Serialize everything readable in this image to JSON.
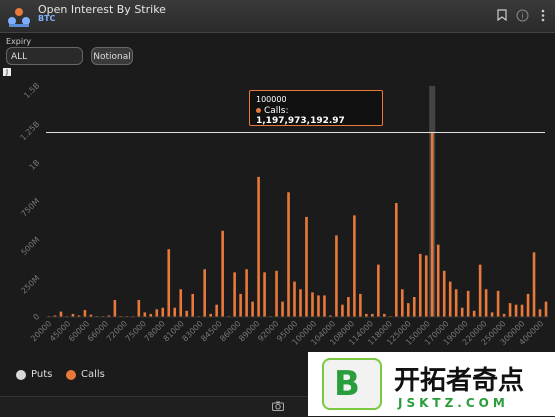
{
  "header": {
    "title": "Open Interest By Strike",
    "subtitle": "BTC"
  },
  "controls": {
    "expiry_label": "Expiry",
    "expiry_value": "ALL",
    "notional_label": "Notional",
    "small_box": "J"
  },
  "icons": {
    "bookmark": "bookmark-icon",
    "info": "info-icon",
    "menu": "menu-icon",
    "camera": "camera-icon"
  },
  "legend": [
    {
      "label": "Puts",
      "color": "#d9d9d9"
    },
    {
      "label": "Calls",
      "color": "#e8793b"
    }
  ],
  "tooltip": {
    "strike": "100000",
    "series": "Calls",
    "value": "1,197,973,192.97"
  },
  "watermark": {
    "cn": "开拓者奇点",
    "en": "JSKTZ.COM"
  },
  "chart_data": {
    "type": "bar",
    "title": "Open Interest By Strike",
    "y_ticks": [
      "0",
      "250M",
      "500M",
      "750M",
      "1B",
      "1.25B",
      "1.5B"
    ],
    "ylim": [
      0,
      1500000000
    ],
    "x_tick_labels": [
      "20000",
      "45000",
      "60000",
      "66000",
      "72000",
      "75000",
      "78000",
      "81000",
      "83000",
      "84500",
      "86000",
      "89000",
      "92000",
      "95000",
      "100000",
      "104000",
      "108000",
      "114000",
      "118000",
      "125000",
      "150000",
      "170000",
      "190000",
      "220000",
      "250000",
      "300000",
      "400000"
    ],
    "reference_line": 1197973192.97,
    "highlight_index": 64,
    "series": [
      {
        "name": "Calls",
        "color": "#e8793b",
        "values": [
          5000000,
          10000000,
          35000000,
          5000000,
          20000000,
          10000000,
          45000000,
          15000000,
          5000000,
          0,
          10000000,
          110000000,
          0,
          0,
          0,
          110000000,
          30000000,
          20000000,
          50000000,
          60000000,
          440000000,
          60000000,
          180000000,
          40000000,
          150000000,
          0,
          310000000,
          20000000,
          80000000,
          560000000,
          0,
          290000000,
          150000000,
          310000000,
          100000000,
          910000000,
          290000000,
          0,
          300000000,
          100000000,
          810000000,
          230000000,
          180000000,
          650000000,
          160000000,
          140000000,
          140000000,
          10000000,
          530000000,
          80000000,
          130000000,
          660000000,
          150000000,
          20000000,
          20000000,
          340000000,
          20000000,
          0,
          740000000,
          180000000,
          90000000,
          130000000,
          410000000,
          400000000,
          1197973192.97,
          470000000,
          300000000,
          230000000,
          180000000,
          60000000,
          170000000,
          40000000,
          340000000,
          180000000,
          30000000,
          170000000,
          20000000,
          90000000,
          80000000,
          80000000,
          150000000,
          420000000,
          50000000,
          100000000
        ]
      }
    ]
  }
}
